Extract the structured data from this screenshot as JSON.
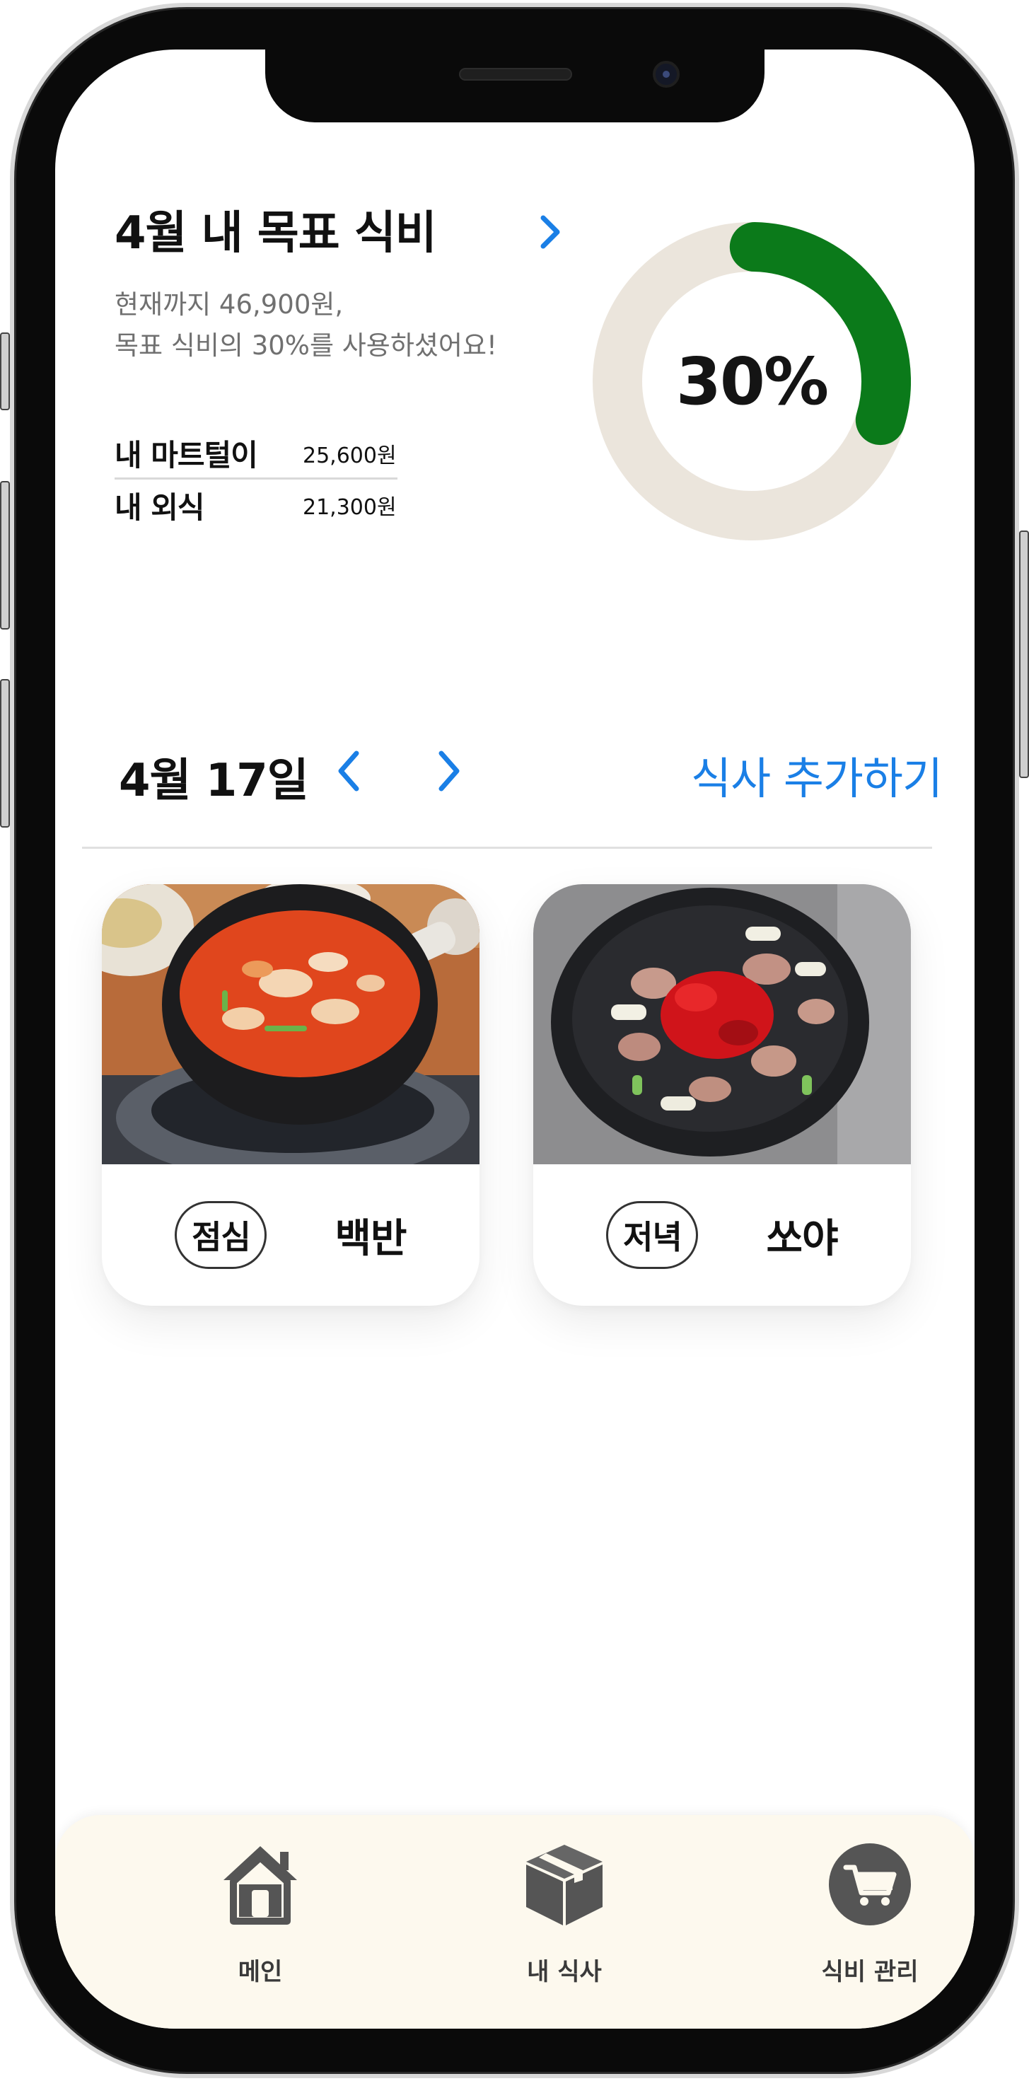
{
  "budget": {
    "title": "4월 내 목표 식비",
    "spent_line": "현재까지 46,900원,",
    "percent_line": "목표 식비의 30%를 사용하셨어요!",
    "percent_used": 0.3,
    "percent_label": "30%",
    "breakdown": [
      {
        "label": "내 마트털이",
        "value": "25,600원"
      },
      {
        "label": "내 외식",
        "value": "21,300원"
      }
    ]
  },
  "meals": {
    "date": "4월 17일",
    "add_label": "식사 추가하기",
    "items": [
      {
        "type": "점심",
        "name": "백반"
      },
      {
        "type": "저녁",
        "name": "쏘야"
      }
    ]
  },
  "nav": {
    "items": [
      {
        "label": "메인",
        "icon": "home-icon"
      },
      {
        "label": "내 식사",
        "icon": "box-icon"
      },
      {
        "label": "식비 관리",
        "icon": "cart-icon"
      }
    ]
  },
  "colors": {
    "accent": "#1a7fe6",
    "progress": "#0b7a1a",
    "track": "#ebe5dc",
    "nav_bg": "#fdf9ee",
    "icon": "#555555"
  }
}
